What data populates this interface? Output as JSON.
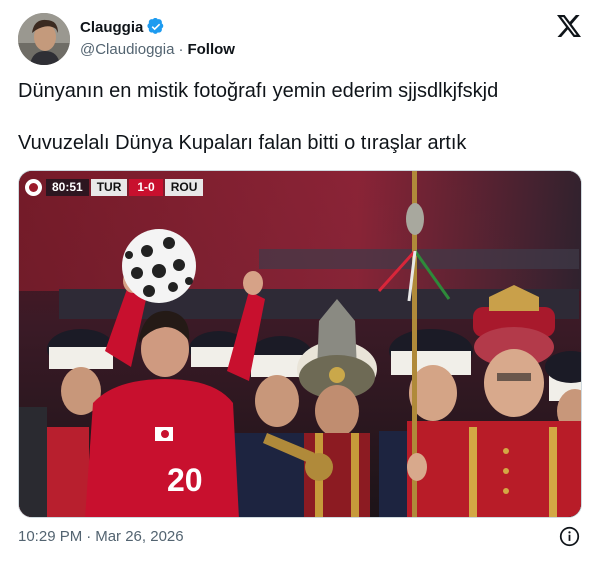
{
  "author": {
    "display_name": "Clauggia",
    "handle": "@Claudioggia",
    "separator": "·",
    "follow_label": "Follow"
  },
  "tweet": {
    "line1": "Dünyanın en mistik fotoğrafı yemin ederim sjjsdlkjfskjd",
    "line2": "Vuvuzelalı Dünya Kupaları falan bitti o tıraşlar artık"
  },
  "media": {
    "scorebug": {
      "time": "80:51",
      "home": "TUR",
      "score": "1-0",
      "away": "ROU"
    },
    "player_number": "20"
  },
  "footer": {
    "time": "10:29 PM",
    "separator": "·",
    "date": "Mar 26, 2026"
  },
  "colors": {
    "verified": "#1d9bf0",
    "text": "#0f1419",
    "secondary": "#536471",
    "jersey": "#c8102e"
  },
  "icons": [
    "verified-badge-icon",
    "x-logo-icon",
    "info-icon"
  ]
}
